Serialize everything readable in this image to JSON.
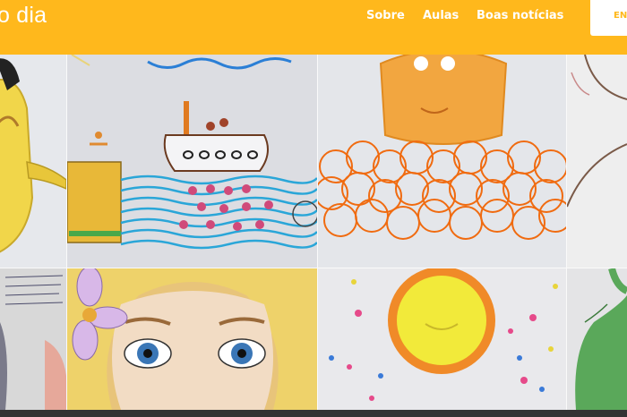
{
  "header": {
    "brand": "o dia",
    "nav": [
      {
        "label": "Sobre"
      },
      {
        "label": "Aulas"
      },
      {
        "label": "Boas notícias"
      }
    ],
    "cta_label": "EN"
  },
  "gallery": {
    "tiles": [
      {
        "subject": "yellow kettle drawing"
      },
      {
        "subject": "ship on sea drawing"
      },
      {
        "subject": "orange sun over scribbles drawing"
      },
      {
        "subject": "line sketch drawing"
      },
      {
        "subject": "handwritten text drawing"
      },
      {
        "subject": "girl face with flower drawing"
      },
      {
        "subject": "sun with stars drawing"
      },
      {
        "subject": "green plant drawing"
      }
    ]
  },
  "colors": {
    "accent": "#FFB81C",
    "footer": "#333333"
  }
}
